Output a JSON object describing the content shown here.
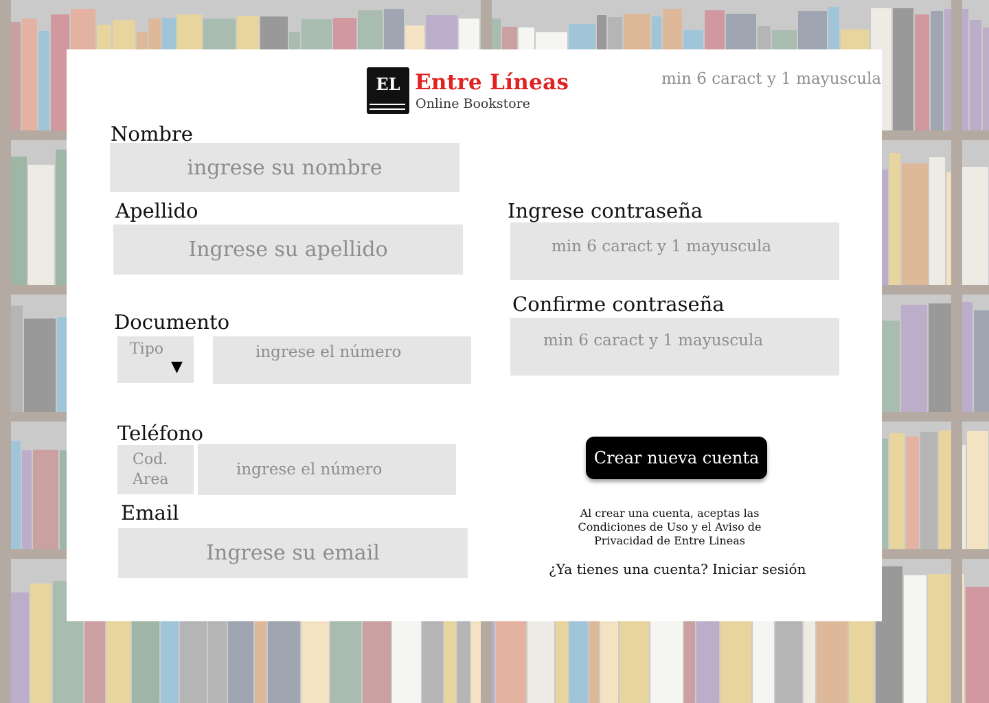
{
  "brand": {
    "mark": "EL",
    "title": "Entre Líneas",
    "subtitle": "Online Bookstore"
  },
  "top_hint": "min 6 caract y 1 mayuscula",
  "form": {
    "nombre": {
      "label": "Nombre",
      "placeholder": "ingrese su nombre"
    },
    "apellido": {
      "label": "Apellido",
      "placeholder": "Ingrese su apellido"
    },
    "documento": {
      "label": "Documento",
      "type_label": "Tipo",
      "type_arrow": "▼",
      "placeholder": "ingrese el número"
    },
    "telefono": {
      "label": "Teléfono",
      "area_line1": "Cod.",
      "area_line2": "Area",
      "placeholder": "ingrese el número"
    },
    "email": {
      "label": "Email",
      "placeholder": "Ingrese su email"
    },
    "password": {
      "label": "Ingrese  contraseña",
      "placeholder": "min 6 caract y 1 mayuscula"
    },
    "confirm": {
      "label": "Confirme contraseña",
      "placeholder": "min 6 caract y 1 mayuscula"
    }
  },
  "actions": {
    "create_label": "Crear nueva cuenta",
    "terms_text": "Al crear una cuenta, aceptas las Condiciones de Uso y el Aviso de Privacidad de Entre Lineas",
    "login_text": "¿Ya tienes una cuenta? Iniciar sesión"
  },
  "colors": {
    "accent": "#e02222",
    "button": "#000000",
    "field": "#e5e5e5",
    "placeholder": "#8d8d8d"
  }
}
